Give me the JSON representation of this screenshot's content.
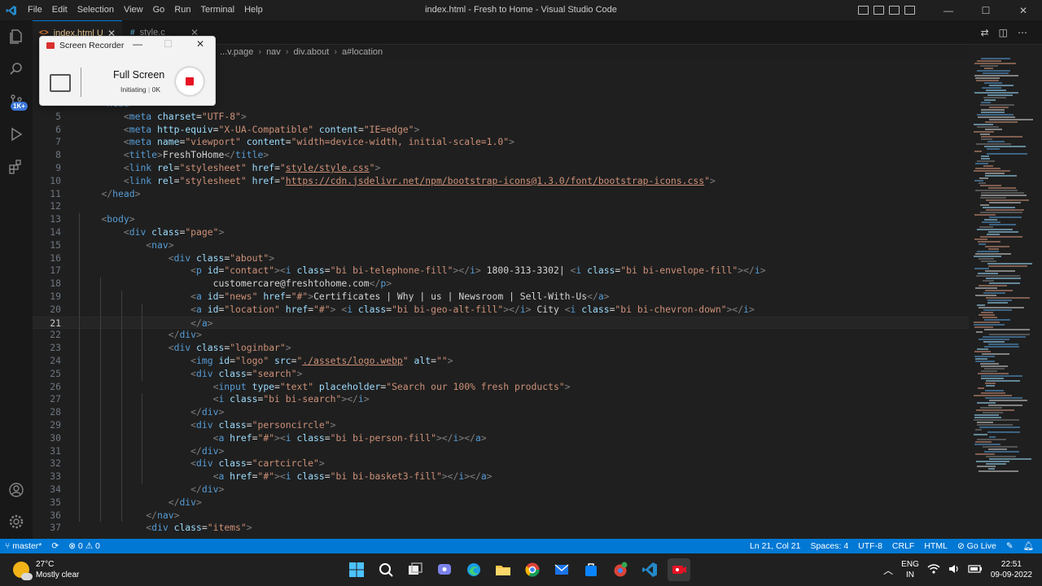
{
  "titlebar": {
    "menu": [
      "File",
      "Edit",
      "Selection",
      "View",
      "Go",
      "Run",
      "Terminal",
      "Help"
    ],
    "window_title": "index.html - Fresh to Home - Visual Studio Code",
    "controls": {
      "minimize": "—",
      "maximize": "☐",
      "close": "✕"
    }
  },
  "activitybar": {
    "icons": [
      "files-icon",
      "search-icon",
      "source-control-icon",
      "run-debug-icon",
      "extensions-icon",
      "account-icon",
      "settings-gear-icon"
    ],
    "scm_badge": "1K+"
  },
  "tabs": [
    {
      "label": "index.html U",
      "icon": "<>",
      "active": true
    },
    {
      "label": "style.c",
      "icon": "#",
      "active": false
    }
  ],
  "breadcrumb": [
    "...v.page",
    "nav",
    "div.about",
    "a#location"
  ],
  "editor": {
    "current_line": 21,
    "lines": [
      {
        "n": "",
        "html": "    <span class='g'>&lt;</span><span class='t'>head</span><span class='g'>&gt;</span>"
      },
      {
        "n": "5",
        "html": "        <span class='g'>&lt;</span><span class='t'>meta</span> <span class='a'>charset</span>=<span class='s'>\"UTF-8\"</span><span class='g'>&gt;</span>"
      },
      {
        "n": "6",
        "html": "        <span class='g'>&lt;</span><span class='t'>meta</span> <span class='a'>http-equiv</span>=<span class='s'>\"X-UA-Compatible\"</span> <span class='a'>content</span>=<span class='s'>\"IE=edge\"</span><span class='g'>&gt;</span>"
      },
      {
        "n": "7",
        "html": "        <span class='g'>&lt;</span><span class='t'>meta</span> <span class='a'>name</span>=<span class='s'>\"viewport\"</span> <span class='a'>content</span>=<span class='s'>\"width=device-width, initial-scale=1.0\"</span><span class='g'>&gt;</span>"
      },
      {
        "n": "8",
        "html": "        <span class='g'>&lt;</span><span class='t'>title</span><span class='g'>&gt;</span>FreshToHome<span class='g'>&lt;/</span><span class='t'>title</span><span class='g'>&gt;</span>"
      },
      {
        "n": "9",
        "html": "        <span class='g'>&lt;</span><span class='t'>link</span> <span class='a'>rel</span>=<span class='s'>\"stylesheet\"</span> <span class='a'>href</span>=<span class='s'>\"</span><span class='u'>style/style.css</span><span class='s'>\"</span><span class='g'>&gt;</span>"
      },
      {
        "n": "10",
        "html": "        <span class='g'>&lt;</span><span class='t'>link</span> <span class='a'>rel</span>=<span class='s'>\"stylesheet\"</span> <span class='a'>href</span>=<span class='s'>\"</span><span class='u'>https://cdn.jsdelivr.net/npm/bootstrap-icons@1.3.0/font/bootstrap-icons.css</span><span class='s'>\"</span><span class='g'>&gt;</span>"
      },
      {
        "n": "11",
        "html": "    <span class='g'>&lt;/</span><span class='t'>head</span><span class='g'>&gt;</span>"
      },
      {
        "n": "12",
        "html": ""
      },
      {
        "n": "13",
        "html": "    <span class='g'>&lt;</span><span class='t'>body</span><span class='g'>&gt;</span>"
      },
      {
        "n": "14",
        "html": "        <span class='g'>&lt;</span><span class='t'>div</span> <span class='a'>class</span>=<span class='s'>\"page\"</span><span class='g'>&gt;</span>"
      },
      {
        "n": "15",
        "html": "            <span class='g'>&lt;</span><span class='t'>nav</span><span class='g'>&gt;</span>"
      },
      {
        "n": "16",
        "html": "                <span class='g'>&lt;</span><span class='t'>div</span> <span class='a'>class</span>=<span class='s'>\"about\"</span><span class='g'>&gt;</span>"
      },
      {
        "n": "17",
        "html": "                    <span class='g'>&lt;</span><span class='t'>p</span> <span class='a'>id</span>=<span class='s'>\"contact\"</span><span class='g'>&gt;&lt;</span><span class='t'>i</span> <span class='a'>class</span>=<span class='s'>\"bi bi-telephone-fill\"</span><span class='g'>&gt;&lt;/</span><span class='t'>i</span><span class='g'>&gt;</span> 1800-313-3302| <span class='g'>&lt;</span><span class='t'>i</span> <span class='a'>class</span>=<span class='s'>\"bi bi-envelope-fill\"</span><span class='g'>&gt;&lt;/</span><span class='t'>i</span><span class='g'>&gt;</span>"
      },
      {
        "n": "18",
        "html": "                        customercare@freshtohome.com<span class='g'>&lt;/</span><span class='t'>p</span><span class='g'>&gt;</span>"
      },
      {
        "n": "19",
        "html": "                    <span class='g'>&lt;</span><span class='t'>a</span> <span class='a'>id</span>=<span class='s'>\"news\"</span> <span class='a'>href</span>=<span class='s'>\"#\"</span><span class='g'>&gt;</span>Certificates | Why | us | Newsroom | Sell-With-Us<span class='g'>&lt;/</span><span class='t'>a</span><span class='g'>&gt;</span>"
      },
      {
        "n": "20",
        "html": "                    <span class='g'>&lt;</span><span class='t'>a</span> <span class='a'>id</span>=<span class='s'>\"location\"</span> <span class='a'>href</span>=<span class='s'>\"#\"</span><span class='g'>&gt;</span> <span class='g'>&lt;</span><span class='t'>i</span> <span class='a'>class</span>=<span class='s'>\"bi bi-geo-alt-fill\"</span><span class='g'>&gt;&lt;/</span><span class='t'>i</span><span class='g'>&gt;</span> City <span class='g'>&lt;</span><span class='t'>i</span> <span class='a'>class</span>=<span class='s'>\"bi bi-chevron-down\"</span><span class='g'>&gt;&lt;/</span><span class='t'>i</span><span class='g'>&gt;</span>"
      },
      {
        "n": "21",
        "html": "                    <span class='g'>&lt;/</span><span class='t'>a</span><span class='g'>&gt;</span>"
      },
      {
        "n": "22",
        "html": "                <span class='g'>&lt;/</span><span class='t'>div</span><span class='g'>&gt;</span>"
      },
      {
        "n": "23",
        "html": "                <span class='g'>&lt;</span><span class='t'>div</span> <span class='a'>class</span>=<span class='s'>\"loginbar\"</span><span class='g'>&gt;</span>"
      },
      {
        "n": "24",
        "html": "                    <span class='g'>&lt;</span><span class='t'>img</span> <span class='a'>id</span>=<span class='s'>\"logo\"</span> <span class='a'>src</span>=<span class='s'>\"</span><span class='u'>./assets/logo.webp</span><span class='s'>\"</span> <span class='a'>alt</span>=<span class='s'>\"\"</span><span class='g'>&gt;</span>"
      },
      {
        "n": "25",
        "html": "                    <span class='g'>&lt;</span><span class='t'>div</span> <span class='a'>class</span>=<span class='s'>\"search\"</span><span class='g'>&gt;</span>"
      },
      {
        "n": "26",
        "html": "                        <span class='g'>&lt;</span><span class='t'>input</span> <span class='a'>type</span>=<span class='s'>\"text\"</span> <span class='a'>placeholder</span>=<span class='s'>\"Search our 100% fresh products\"</span><span class='g'>&gt;</span>"
      },
      {
        "n": "27",
        "html": "                        <span class='g'>&lt;</span><span class='t'>i</span> <span class='a'>class</span>=<span class='s'>\"bi bi-search\"</span><span class='g'>&gt;&lt;/</span><span class='t'>i</span><span class='g'>&gt;</span>"
      },
      {
        "n": "28",
        "html": "                    <span class='g'>&lt;/</span><span class='t'>div</span><span class='g'>&gt;</span>"
      },
      {
        "n": "29",
        "html": "                    <span class='g'>&lt;</span><span class='t'>div</span> <span class='a'>class</span>=<span class='s'>\"personcircle\"</span><span class='g'>&gt;</span>"
      },
      {
        "n": "30",
        "html": "                        <span class='g'>&lt;</span><span class='t'>a</span> <span class='a'>href</span>=<span class='s'>\"#\"</span><span class='g'>&gt;&lt;</span><span class='t'>i</span> <span class='a'>class</span>=<span class='s'>\"bi bi-person-fill\"</span><span class='g'>&gt;&lt;/</span><span class='t'>i</span><span class='g'>&gt;&lt;/</span><span class='t'>a</span><span class='g'>&gt;</span>"
      },
      {
        "n": "31",
        "html": "                    <span class='g'>&lt;/</span><span class='t'>div</span><span class='g'>&gt;</span>"
      },
      {
        "n": "32",
        "html": "                    <span class='g'>&lt;</span><span class='t'>div</span> <span class='a'>class</span>=<span class='s'>\"cartcircle\"</span><span class='g'>&gt;</span>"
      },
      {
        "n": "33",
        "html": "                        <span class='g'>&lt;</span><span class='t'>a</span> <span class='a'>href</span>=<span class='s'>\"#\"</span><span class='g'>&gt;&lt;</span><span class='t'>i</span> <span class='a'>class</span>=<span class='s'>\"bi bi-basket3-fill\"</span><span class='g'>&gt;&lt;/</span><span class='t'>i</span><span class='g'>&gt;&lt;/</span><span class='t'>a</span><span class='g'>&gt;</span>"
      },
      {
        "n": "34",
        "html": "                    <span class='g'>&lt;/</span><span class='t'>div</span><span class='g'>&gt;</span>"
      },
      {
        "n": "35",
        "html": "                <span class='g'>&lt;/</span><span class='t'>div</span><span class='g'>&gt;</span>"
      },
      {
        "n": "36",
        "html": "            <span class='g'>&lt;/</span><span class='t'>nav</span><span class='g'>&gt;</span>"
      },
      {
        "n": "37",
        "html": "            <span class='g'>&lt;</span><span class='t'>div</span> <span class='a'>class</span>=<span class='s'>\"items\"</span><span class='g'>&gt;</span>"
      }
    ]
  },
  "recorder": {
    "title": "Screen Recorder",
    "mode": "Full Screen",
    "status": "Initiating",
    "size": "0K"
  },
  "statusbar": {
    "branch": "master*",
    "problems": "⊗ 0 ⚠ 0",
    "position": "Ln 21, Col 21",
    "spaces": "Spaces: 4",
    "encoding": "UTF-8",
    "eol": "CRLF",
    "language": "HTML",
    "golive": "Go Live"
  },
  "taskbar": {
    "temp": "27°C",
    "weather": "Mostly clear",
    "lang1": "ENG",
    "lang2": "IN",
    "time": "22:51",
    "date": "09-09-2022"
  },
  "colors": {
    "accent": "#0078d4",
    "editor_bg": "#1f1f1f",
    "tag": "#569cd6",
    "attr": "#9cdcfe",
    "string": "#ce9178"
  }
}
